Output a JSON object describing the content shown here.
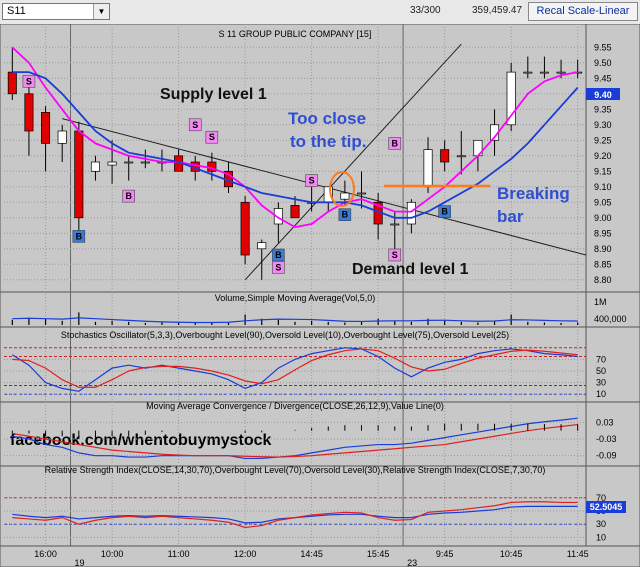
{
  "toolbar": {
    "symbol": "S11",
    "bar_counter": "33/300",
    "last_price": "359,459.47",
    "scale_button": "Recal Scale-Linear"
  },
  "price_panel": {
    "title": "S 11 GROUP PUBLIC COMPANY [15]",
    "y_ticks": [
      "9.55",
      "9.50",
      "9.45",
      "9.40",
      "9.35",
      "9.30",
      "9.25",
      "9.20",
      "9.15",
      "9.10",
      "9.05",
      "9.00",
      "8.95",
      "8.90",
      "8.85",
      "8.80"
    ],
    "current_price_label": "9.40",
    "annotations": {
      "supply": "Supply level 1",
      "demand": "Demand level 1",
      "too_close_1": "Too close",
      "too_close_2": "to the tip.",
      "breaking_1": "Breaking",
      "breaking_2": "bar"
    },
    "signal_labels": {
      "buy": "B",
      "sell": "S"
    }
  },
  "volume_panel": {
    "title": "Volume,Simple Moving Average(Vol,5,0)",
    "y_ticks": [
      "1M",
      "400,000"
    ]
  },
  "stoch_panel": {
    "title": "Stochastics Oscillator(5,3,3),Overbought Level(90),Oversold Level(10),Overbought Level(75),Oversold Level(25)",
    "y_ticks": [
      "70",
      "50",
      "30",
      "10"
    ]
  },
  "macd_panel": {
    "title": "Moving Average Convergence / Divergence(CLOSE,26,12,9),Value Line(0)",
    "y_ticks": [
      "0.03",
      "-0.03",
      "-0.09"
    ],
    "watermark": "facebook.com/whentobuymystock"
  },
  "rsi_panel": {
    "title": "Relative Strength Index(CLOSE,14,30,70),Overbought Level(70),Oversold Level(30),Relative Strength Index(CLOSE,7,30,70)",
    "y_ticks": [
      "70",
      "50",
      "30",
      "10"
    ],
    "current_value_label": "52.5045"
  },
  "time_axis": {
    "labels": [
      "16:00",
      "10:00",
      "11:00",
      "12:00",
      "14:45",
      "15:45",
      "9:45",
      "10:45",
      "11:45"
    ],
    "day_labels": [
      "19",
      "23"
    ]
  },
  "colors": {
    "bull": "#ffffff",
    "bear": "#e00000",
    "ma_fast": "#ff00ff",
    "ma_slow": "#1a3cd8",
    "annotation_blue": "#2f4fd0",
    "breaking_bar": "#ff7a1a"
  },
  "chart_data": [
    {
      "type": "candlestick",
      "title": "S 11 GROUP PUBLIC COMPANY [15]",
      "ylim": [
        8.78,
        9.58
      ],
      "candles": [
        {
          "o": 9.47,
          "h": 9.55,
          "l": 9.38,
          "c": 9.4
        },
        {
          "o": 9.4,
          "h": 9.44,
          "l": 9.2,
          "c": 9.28
        },
        {
          "o": 9.34,
          "h": 9.36,
          "l": 9.15,
          "c": 9.24
        },
        {
          "o": 9.24,
          "h": 9.3,
          "l": 9.18,
          "c": 9.28
        },
        {
          "o": 9.28,
          "h": 9.31,
          "l": 8.96,
          "c": 9.0
        },
        {
          "o": 9.15,
          "h": 9.2,
          "l": 9.12,
          "c": 9.18
        },
        {
          "o": 9.17,
          "h": 9.25,
          "l": 9.11,
          "c": 9.18
        },
        {
          "o": 9.18,
          "h": 9.2,
          "l": 9.12,
          "c": 9.18
        },
        {
          "o": 9.18,
          "h": 9.22,
          "l": 9.16,
          "c": 9.18
        },
        {
          "o": 9.18,
          "h": 9.22,
          "l": 9.15,
          "c": 9.18
        },
        {
          "o": 9.2,
          "h": 9.22,
          "l": 9.15,
          "c": 9.15
        },
        {
          "o": 9.18,
          "h": 9.2,
          "l": 9.12,
          "c": 9.15
        },
        {
          "o": 9.18,
          "h": 9.21,
          "l": 9.12,
          "c": 9.15
        },
        {
          "o": 9.15,
          "h": 9.18,
          "l": 9.08,
          "c": 9.1
        },
        {
          "o": 9.05,
          "h": 9.07,
          "l": 8.85,
          "c": 8.88
        },
        {
          "o": 8.9,
          "h": 8.93,
          "l": 8.8,
          "c": 8.92
        },
        {
          "o": 8.98,
          "h": 9.05,
          "l": 8.92,
          "c": 9.03
        },
        {
          "o": 9.04,
          "h": 9.07,
          "l": 9.0,
          "c": 9.0
        },
        {
          "o": 9.05,
          "h": 9.1,
          "l": 9.02,
          "c": 9.05
        },
        {
          "o": 9.05,
          "h": 9.1,
          "l": 9.02,
          "c": 9.1
        },
        {
          "o": 9.06,
          "h": 9.12,
          "l": 9.04,
          "c": 9.08
        },
        {
          "o": 9.08,
          "h": 9.15,
          "l": 9.03,
          "c": 9.08
        },
        {
          "o": 9.05,
          "h": 9.08,
          "l": 8.93,
          "c": 8.98
        },
        {
          "o": 8.98,
          "h": 9.02,
          "l": 8.9,
          "c": 8.98
        },
        {
          "o": 8.98,
          "h": 9.06,
          "l": 8.95,
          "c": 9.05
        },
        {
          "o": 9.1,
          "h": 9.26,
          "l": 9.08,
          "c": 9.22
        },
        {
          "o": 9.22,
          "h": 9.25,
          "l": 9.15,
          "c": 9.18
        },
        {
          "o": 9.2,
          "h": 9.28,
          "l": 9.14,
          "c": 9.2
        },
        {
          "o": 9.2,
          "h": 9.25,
          "l": 9.15,
          "c": 9.25
        },
        {
          "o": 9.25,
          "h": 9.35,
          "l": 9.2,
          "c": 9.3
        },
        {
          "o": 9.3,
          "h": 9.5,
          "l": 9.28,
          "c": 9.47
        },
        {
          "o": 9.47,
          "h": 9.52,
          "l": 9.45,
          "c": 9.47
        },
        {
          "o": 9.47,
          "h": 9.52,
          "l": 9.45,
          "c": 9.47
        },
        {
          "o": 9.47,
          "h": 9.51,
          "l": 9.45,
          "c": 9.47
        },
        {
          "o": 9.47,
          "h": 9.51,
          "l": 9.45,
          "c": 9.47
        }
      ],
      "ma_fast": [
        9.55,
        9.5,
        9.42,
        9.35,
        9.28,
        9.24,
        9.22,
        9.2,
        9.19,
        9.18,
        9.18,
        9.17,
        9.16,
        9.14,
        9.1,
        9.04,
        9.0,
        8.97,
        8.98,
        9.02,
        9.05,
        9.06,
        9.04,
        9.02,
        9.02,
        9.06,
        9.1,
        9.15,
        9.2,
        9.26,
        9.33,
        9.4,
        9.44,
        9.46,
        9.47
      ],
      "ma_slow": [
        9.47,
        9.47,
        9.45,
        9.4,
        9.34,
        9.28,
        9.24,
        9.21,
        9.2,
        9.19,
        9.18,
        9.16,
        9.14,
        9.12,
        9.1,
        9.08,
        9.07,
        9.06,
        9.05,
        9.05,
        9.05,
        9.04,
        9.02,
        9.0,
        9.0,
        9.02,
        9.05,
        9.08,
        9.11,
        9.15,
        9.19,
        9.24,
        9.3,
        9.36,
        9.42
      ],
      "buy_signals": [
        {
          "i": 4,
          "p": 8.94
        },
        {
          "i": 7,
          "p": 9.07
        },
        {
          "i": 16,
          "p": 8.88
        },
        {
          "i": 20,
          "p": 9.01
        },
        {
          "i": 23,
          "p": 9.24
        },
        {
          "i": 26,
          "p": 9.02
        }
      ],
      "sell_signals": [
        {
          "i": 1,
          "p": 9.44
        },
        {
          "i": 11,
          "p": 9.3
        },
        {
          "i": 12,
          "p": 9.26
        },
        {
          "i": 18,
          "p": 9.12
        },
        {
          "i": 23,
          "p": 8.88
        },
        {
          "i": 16,
          "p": 8.84
        }
      ]
    },
    {
      "type": "bar",
      "title": "Volume,Simple Moving Average(Vol,5,0)",
      "values": [
        0.25,
        0.35,
        0.3,
        0.2,
        0.6,
        0.15,
        0.2,
        0.15,
        0.1,
        0.15,
        0.1,
        0.1,
        0.12,
        0.15,
        0.5,
        0.3,
        0.25,
        0.15,
        0.2,
        0.15,
        0.12,
        0.18,
        0.3,
        0.2,
        0.15,
        0.3,
        0.2,
        0.15,
        0.12,
        0.2,
        0.5,
        0.15,
        0.12,
        0.1,
        0.12
      ],
      "sma": [
        0.3,
        0.32,
        0.3,
        0.28,
        0.34,
        0.3,
        0.26,
        0.22,
        0.18,
        0.15,
        0.13,
        0.12,
        0.12,
        0.13,
        0.2,
        0.25,
        0.28,
        0.27,
        0.26,
        0.22,
        0.18,
        0.17,
        0.19,
        0.2,
        0.2,
        0.22,
        0.23,
        0.2,
        0.18,
        0.19,
        0.25,
        0.24,
        0.22,
        0.2,
        0.19
      ],
      "ylabel_ticks": [
        "1M",
        "400,000"
      ]
    },
    {
      "type": "line",
      "title": "Stochastics Oscillator(5,3,3),Overbought Level(90),Oversold Level(10),Overbought Level(75),Oversold Level(25)",
      "ylim": [
        0,
        100
      ],
      "levels": [
        90,
        10,
        75,
        25
      ],
      "series": [
        {
          "name": "%K",
          "values": [
            78,
            60,
            30,
            20,
            15,
            35,
            55,
            60,
            55,
            60,
            55,
            50,
            45,
            35,
            20,
            30,
            55,
            70,
            80,
            85,
            90,
            88,
            75,
            55,
            40,
            55,
            65,
            70,
            80,
            85,
            88,
            85,
            80,
            78,
            75
          ]
        },
        {
          "name": "%D",
          "values": [
            70,
            68,
            55,
            35,
            22,
            22,
            35,
            50,
            56,
            58,
            58,
            55,
            50,
            43,
            33,
            28,
            35,
            52,
            68,
            78,
            85,
            88,
            85,
            72,
            57,
            50,
            53,
            63,
            72,
            78,
            84,
            86,
            84,
            81,
            78
          ]
        }
      ]
    },
    {
      "type": "line",
      "title": "Moving Average Convergence / Divergence(CLOSE,26,12,9),Value Line(0)",
      "ylim": [
        -0.12,
        0.06
      ],
      "series": [
        {
          "name": "MACD",
          "values": [
            -0.02,
            -0.03,
            -0.05,
            -0.06,
            -0.08,
            -0.09,
            -0.09,
            -0.095,
            -0.095,
            -0.09,
            -0.09,
            -0.09,
            -0.09,
            -0.09,
            -0.1,
            -0.1,
            -0.095,
            -0.09,
            -0.08,
            -0.07,
            -0.06,
            -0.055,
            -0.05,
            -0.05,
            -0.045,
            -0.035,
            -0.025,
            -0.015,
            -0.005,
            0.005,
            0.015,
            0.025,
            0.032,
            0.038,
            0.045
          ]
        },
        {
          "name": "Signal",
          "values": [
            -0.01,
            -0.02,
            -0.03,
            -0.04,
            -0.05,
            -0.06,
            -0.07,
            -0.075,
            -0.08,
            -0.085,
            -0.088,
            -0.09,
            -0.09,
            -0.09,
            -0.092,
            -0.094,
            -0.095,
            -0.093,
            -0.09,
            -0.085,
            -0.08,
            -0.075,
            -0.07,
            -0.065,
            -0.06,
            -0.055,
            -0.05,
            -0.04,
            -0.03,
            -0.02,
            -0.01,
            0.0,
            0.008,
            0.015,
            0.022
          ]
        }
      ],
      "histogram": [
        -0.01,
        -0.01,
        -0.02,
        -0.02,
        -0.03,
        -0.03,
        -0.02,
        -0.02,
        -0.015,
        -0.005,
        0,
        0,
        0,
        0,
        -0.008,
        -0.006,
        0,
        0.003,
        0.01,
        0.015,
        0.02,
        0.02,
        0.02,
        0.015,
        0.015,
        0.02,
        0.025,
        0.025,
        0.025,
        0.025,
        0.025,
        0.025,
        0.024,
        0.023,
        0.023
      ]
    },
    {
      "type": "line",
      "title": "Relative Strength Index(CLOSE,14,30,70),Overbought Level(70),Oversold Level(30),Relative Strength Index(CLOSE,7,30,70)",
      "ylim": [
        0,
        100
      ],
      "levels": [
        70,
        30
      ],
      "series": [
        {
          "name": "RSI14",
          "values": [
            45,
            42,
            40,
            42,
            38,
            40,
            42,
            43,
            42,
            43,
            42,
            41,
            40,
            38,
            32,
            33,
            38,
            40,
            42,
            44,
            45,
            45,
            42,
            40,
            40,
            45,
            47,
            48,
            50,
            52,
            56,
            57,
            57,
            57,
            57
          ]
        },
        {
          "name": "RSI7",
          "values": [
            40,
            38,
            36,
            40,
            30,
            36,
            40,
            42,
            40,
            42,
            40,
            38,
            36,
            33,
            25,
            28,
            36,
            40,
            44,
            46,
            48,
            47,
            40,
            36,
            37,
            48,
            50,
            52,
            55,
            58,
            63,
            64,
            64,
            63,
            63
          ]
        }
      ]
    }
  ]
}
